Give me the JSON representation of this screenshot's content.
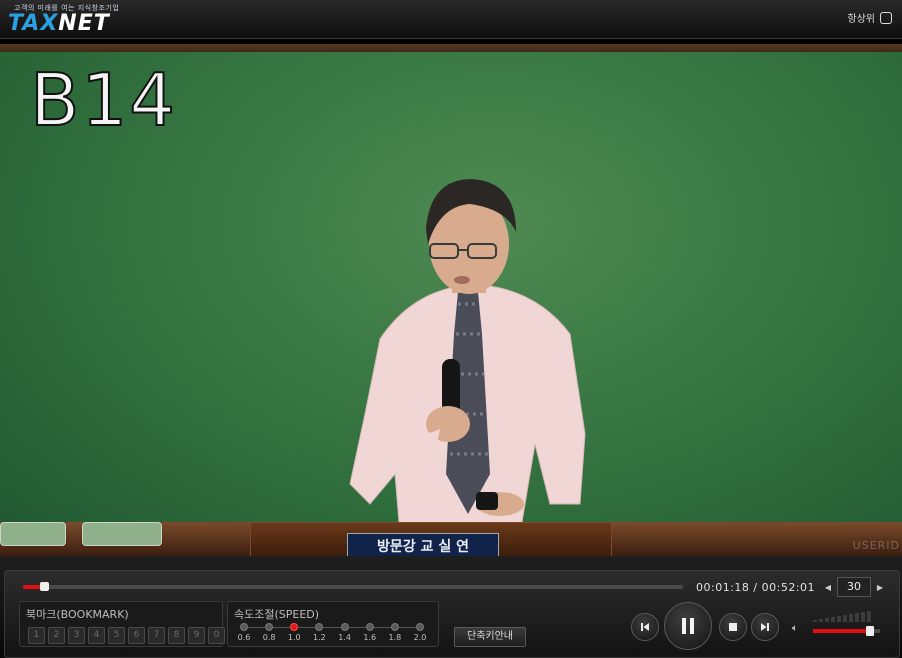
{
  "header": {
    "tagline": "고객의 미래를 여는 지식창조기업",
    "logo_tax": "TAX",
    "logo_net": "NET",
    "always_on_top_label": "항상위"
  },
  "video": {
    "lecture_code": "B14",
    "podium_text": "방문강 교 실 연",
    "watermark": "USERID"
  },
  "controls": {
    "progress_fraction": 0.025,
    "current_time": "00:01:18",
    "duration": "00:52:01",
    "time_separator": "/",
    "skip_seconds": "30",
    "bookmark_title": "북마크(BOOKMARK)",
    "bookmark_keys": [
      "1",
      "2",
      "3",
      "4",
      "5",
      "6",
      "7",
      "8",
      "9",
      "0"
    ],
    "speed_title": "속도조절(SPEED)",
    "speed_options": [
      "0.6",
      "0.8",
      "1.0",
      "1.2",
      "1.4",
      "1.6",
      "1.8",
      "2.0"
    ],
    "speed_selected": "1.0",
    "shortcut_label": "단축키안내",
    "volume_fraction": 0.85,
    "accent_color": "#e01010"
  },
  "icons": [
    "skip-back-icon",
    "skip-forward-icon",
    "prev-icon",
    "pause-icon",
    "stop-icon",
    "next-icon",
    "volume-icon",
    "checkbox-icon"
  ]
}
